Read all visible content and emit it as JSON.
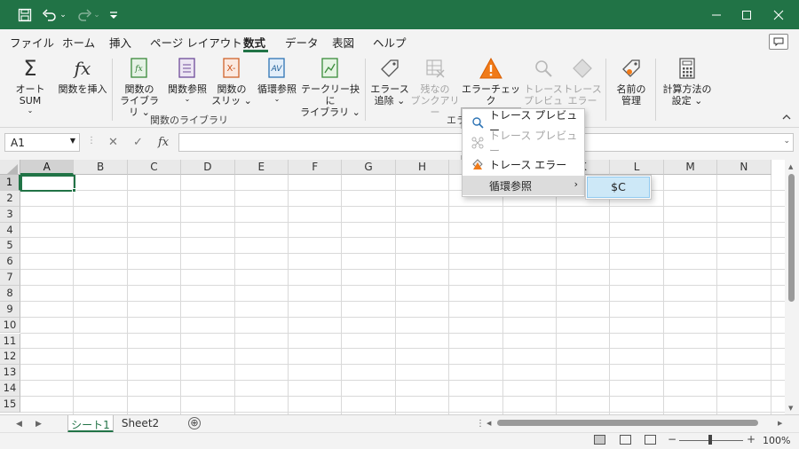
{
  "colors": {
    "accent": "#217346",
    "menu_highlight": "#cde8f7"
  },
  "titlebar": {
    "icons": [
      "save-icon",
      "undo-icon",
      "redo-icon",
      "customize-qat-icon"
    ],
    "win_icons": [
      "minimize-icon",
      "maximize-icon",
      "close-icon"
    ]
  },
  "tabs": [
    {
      "label": "ファイル"
    },
    {
      "label": "ホーム"
    },
    {
      "label": "挿入"
    },
    {
      "label": "ページ レイアウト"
    },
    {
      "label": "数式",
      "active": true
    },
    {
      "label": "データ"
    },
    {
      "label": "表図"
    },
    {
      "label": "ヘルプ"
    }
  ],
  "ribbon": {
    "autosum": {
      "l1": "オートSUM",
      "l2": "⌄"
    },
    "insert_fn": {
      "l1": "関数を挿入"
    },
    "fn_library": {
      "l1": "関数の",
      "l2": "ライブラリ ⌄"
    },
    "fn_ref": {
      "l1": "関数参照",
      "l2": "⌄"
    },
    "fn_slip": {
      "l1": "関数の",
      "l2": "スリッ ⌄"
    },
    "circ_ref": {
      "l1": "循環参照",
      "l2": "⌄"
    },
    "text_lib": {
      "l1": "テークリー抉に",
      "l2": "ライブラリ ⌄"
    },
    "group1_label": "関数のライブラリ",
    "trace_prec": {
      "l1": "エラース",
      "l2": "追除 ⌄"
    },
    "remove_arrows": {
      "l1": "残なの",
      "l2": "ブンクアリー"
    },
    "error_check": {
      "l1": "エラーチェック",
      "l2": "⌄"
    },
    "trace_preview": {
      "l1": "トレース",
      "l2": "プレビュー"
    },
    "trace_error": {
      "l1": "トレース",
      "l2": "エラー"
    },
    "group2_label": "エラ",
    "name_mgr": {
      "l1": "名前の",
      "l2": "管理"
    },
    "calc": {
      "l1": "計算方法の",
      "l2": "設定 ⌄"
    }
  },
  "formula_bar": {
    "name_box": "A1",
    "cancel": "✕",
    "enter": "✓",
    "fx": "fx",
    "value": ""
  },
  "grid": {
    "columns": [
      "A",
      "B",
      "C",
      "D",
      "E",
      "F",
      "G",
      "H",
      "I",
      "J",
      "K",
      "L",
      "M",
      "N"
    ],
    "rows": [
      "1",
      "2",
      "3",
      "4",
      "5",
      "6",
      "7",
      "8",
      "9",
      "10",
      "11",
      "12",
      "13",
      "14",
      "15"
    ],
    "active_cell": "A1"
  },
  "dropdown": {
    "items": [
      {
        "label": "トレース プレビュー",
        "icon": "magnifier-icon",
        "enabled": true
      },
      {
        "label": "トレース プレビュー",
        "icon": "network-icon",
        "enabled": false
      },
      {
        "label": "トレース エラー",
        "icon": "warning-icon",
        "enabled": true
      },
      {
        "label": "循環参照",
        "icon": "",
        "enabled": true,
        "submenu": true
      }
    ],
    "submenu_item": "$C"
  },
  "sheets": [
    {
      "label": "シート1",
      "active": true
    },
    {
      "label": "Sheet2",
      "active": false
    }
  ],
  "status": {
    "zoom": "100%",
    "zoom_minus": "−",
    "zoom_plus": "+",
    "add_sheet": "⊕"
  }
}
